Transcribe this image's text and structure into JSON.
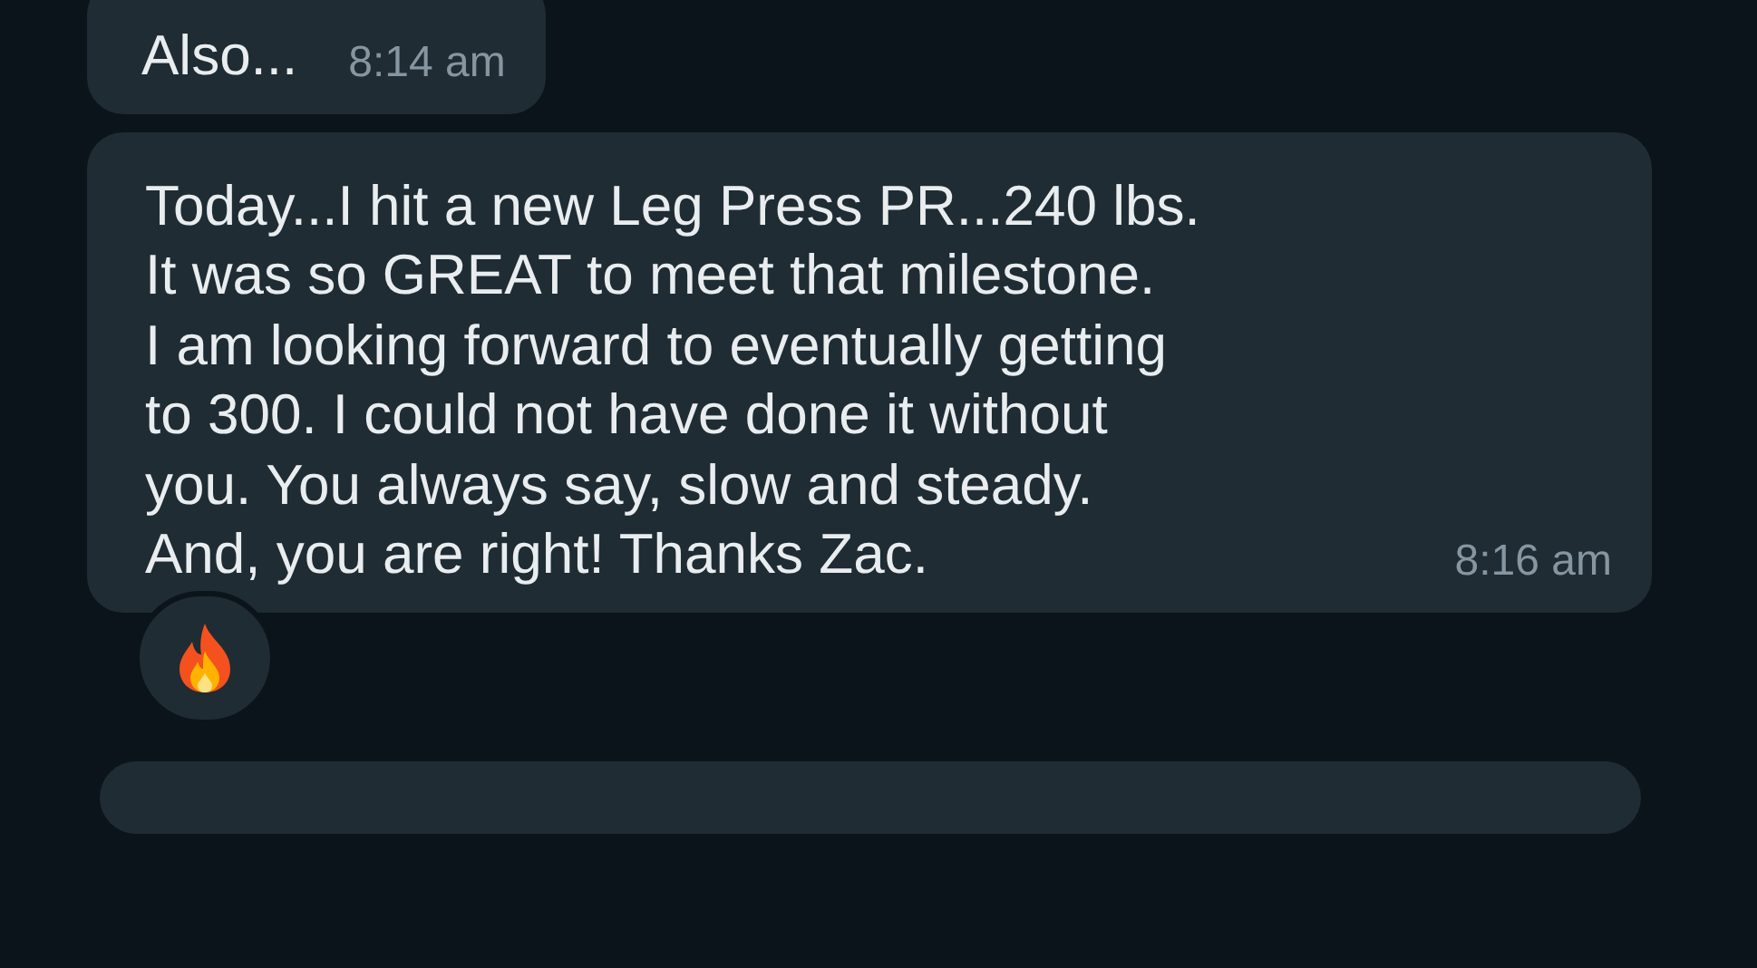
{
  "messages": [
    {
      "text": "Also...",
      "time": "8:14 am",
      "reaction": false
    },
    {
      "text": "Today...I hit a new Leg Press PR...240 lbs.\nIt was so GREAT to meet that milestone.\nI am looking forward to eventually getting\nto 300. I could not have done it without\nyou. You always say, slow and steady.\nAnd, you are right! Thanks Zac.",
      "time": "8:16 am",
      "reaction": true
    }
  ]
}
